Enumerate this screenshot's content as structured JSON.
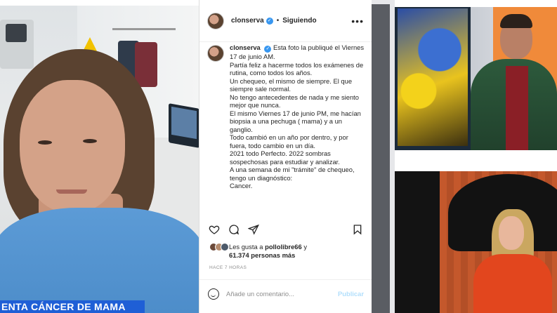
{
  "lower_third": {
    "text": "ENTA CÁNCER DE MAMA"
  },
  "post": {
    "username": "clonserva",
    "separator": "•",
    "follow_status": "Siguiendo",
    "more": "•••",
    "caption_lines": [
      "Esta foto la publiqué el Viernes 17 de junio AM.",
      "Partía feliz a hacerme todos los exámenes de rutina, como todos los años.",
      "Un chequeo, el mismo de siempre. El que siempre sale normal.",
      "No tengo antecedentes de nada y me siento mejor que nunca.",
      "El mismo Viernes 17 de junio PM, me hacían biopsia a una pechuga ( mama) y a un ganglio.",
      "Todo cambió en un año por dentro, y por fuera, todo cambio en un día.",
      "2021 todo Perfecto. 2022 sombras sospechosas para estudiar y analizar.",
      "A una semana de mi \"trámite\" de chequeo, tengo un diagnóstico:",
      "Cancer."
    ],
    "likes_prefix": "Les gusta a",
    "likes_user": "pollolibre66",
    "likes_and": "y",
    "likes_count": "61.374 personas más",
    "timestamp": "HACE 7 HORAS",
    "comment_placeholder": "Añade un comentario...",
    "publish_label": "Publicar"
  },
  "icons": {
    "like": "heart-icon",
    "comment": "comment-icon",
    "share": "share-icon",
    "save": "bookmark-icon",
    "verified": "verified-badge-icon",
    "emoji": "emoji-icon"
  },
  "colors": {
    "verified_blue": "#3897f0",
    "lower_third_blue": "#1f5fd6",
    "publish_disabled": "#b2dffc"
  }
}
